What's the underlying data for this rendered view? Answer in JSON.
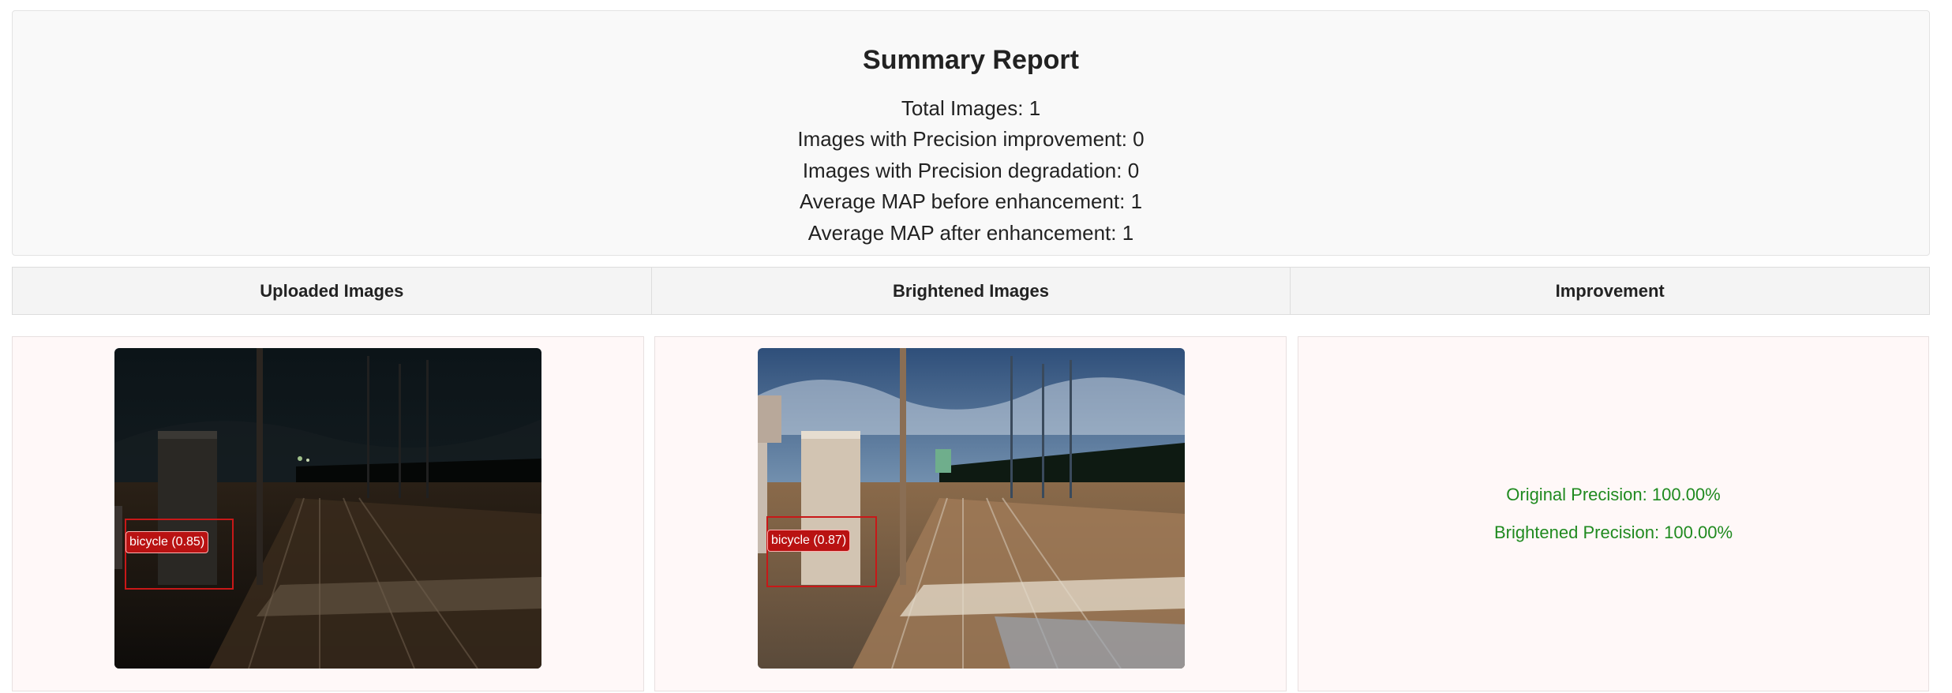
{
  "summary": {
    "title": "Summary Report",
    "total_images": "Total Images: 1",
    "precision_improvement": "Images with Precision improvement: 0",
    "precision_degradation": "Images with Precision degradation: 0",
    "avg_map_before": "Average MAP before enhancement: 1",
    "avg_map_after": "Average MAP after enhancement: 1"
  },
  "columns": {
    "uploaded": "Uploaded Images",
    "brightened": "Brightened Images",
    "improvement": "Improvement"
  },
  "results": [
    {
      "uploaded_detection": "bicycle (0.85)",
      "brightened_detection": "bicycle (0.87)",
      "original_precision": "Original Precision: 100.00%",
      "brightened_precision": "Brightened Precision: 100.00%"
    }
  ],
  "colors": {
    "detection_box": "#c81818",
    "precision_text": "#1f8a1f"
  }
}
